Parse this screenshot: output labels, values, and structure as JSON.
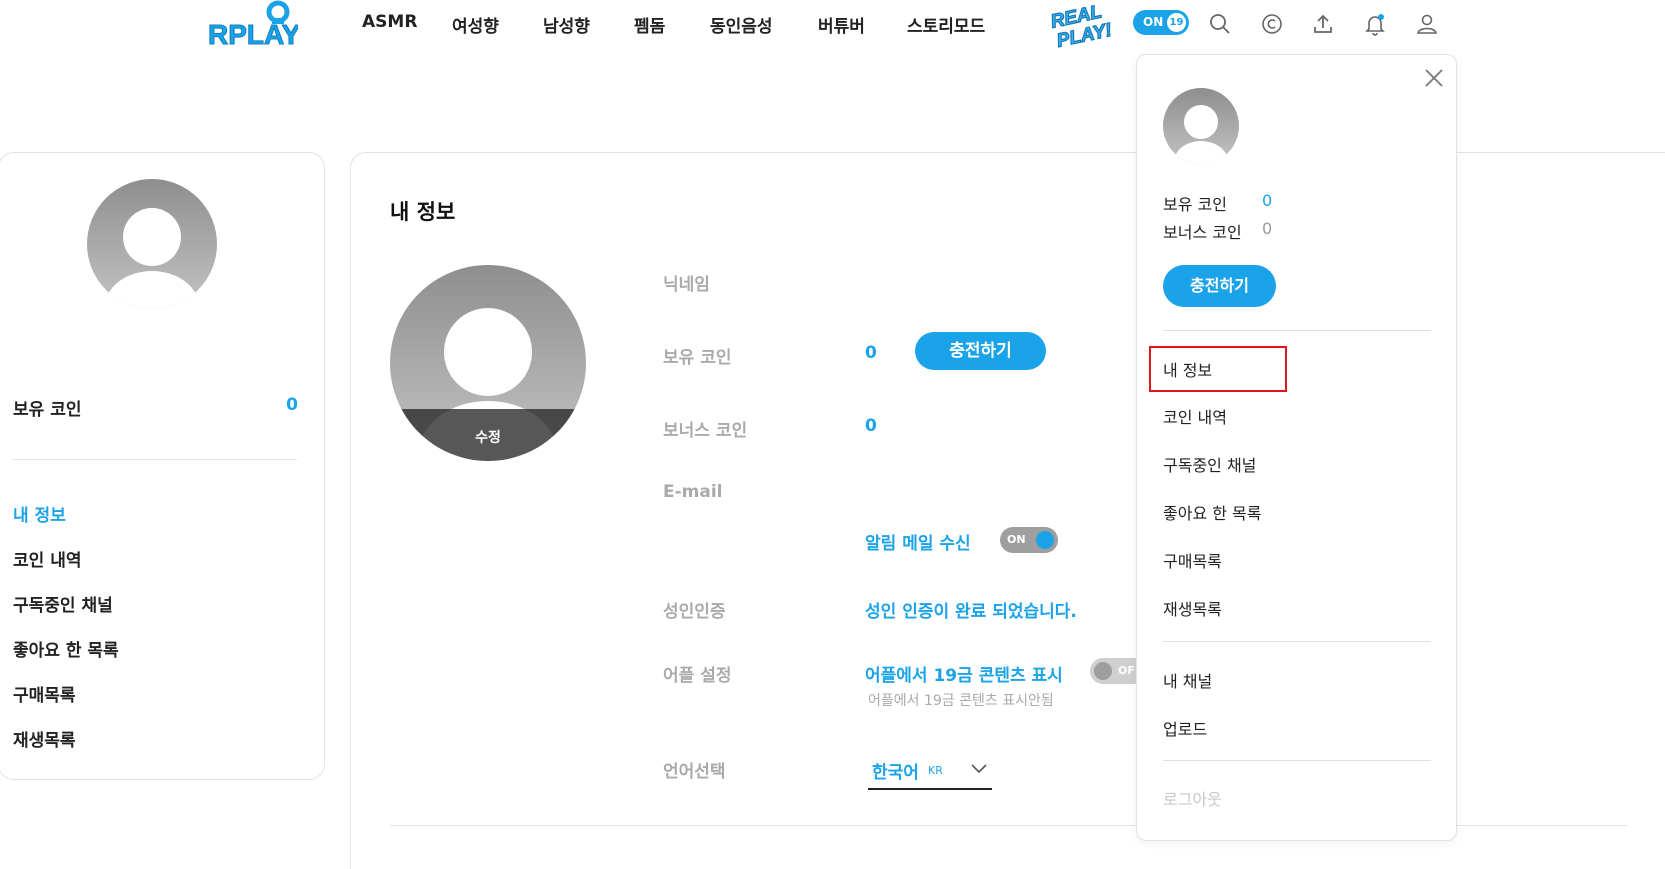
{
  "header": {
    "logo_text": "RPLAY",
    "nav": [
      "ASMR",
      "여성향",
      "남성향",
      "펨돔",
      "동인음성",
      "버튜버",
      "스토리모드"
    ],
    "realplay_text": "REAL PLAY!",
    "on_label": "ON",
    "age_badge": "19",
    "icons": [
      "search-icon",
      "copyright-icon",
      "upload-icon",
      "notification-bell-icon",
      "user-icon"
    ]
  },
  "sidebar": {
    "coin_label": "보유 코인",
    "coin_value": "0",
    "menu": [
      "내 정보",
      "코인 내역",
      "구독중인 채널",
      "좋아요 한 목록",
      "구매목록",
      "재생목록"
    ],
    "active_index": 0
  },
  "main": {
    "title": "내 정보",
    "edit_label": "수정",
    "fields": {
      "nickname_label": "닉네임",
      "coin_label": "보유 코인",
      "coin_value": "0",
      "charge_label": "충전하기",
      "bonus_label": "보너스 코인",
      "bonus_value": "0",
      "email_label": "E-mail",
      "mail_receive_label": "알림 메일 수신",
      "mail_toggle": "ON",
      "adult_label": "성인인증",
      "adult_status": "성인 인증이 완료 되었습니다.",
      "app_label": "어플 설정",
      "app_setting": "어플에서 19금 콘텐츠 표시",
      "app_toggle": "OFF",
      "app_hint": "어플에서 19금 콘텐츠 표시안됨",
      "lang_label": "언어선택",
      "lang_value": "한국어",
      "lang_code": "KR"
    }
  },
  "dropdown": {
    "coin_label": "보유 코인",
    "coin_value": "0",
    "bonus_label": "보너스 코인",
    "bonus_value": "0",
    "charge_label": "충전하기",
    "menu": [
      "내 정보",
      "코인 내역",
      "구독중인 채널",
      "좋아요 한 목록",
      "구매목록",
      "재생목록"
    ],
    "menu2": [
      "내 채널",
      "업로드"
    ],
    "logout": "로그아웃"
  },
  "colors": {
    "accent": "#1aa3e8",
    "highlight": "#e0141c"
  }
}
